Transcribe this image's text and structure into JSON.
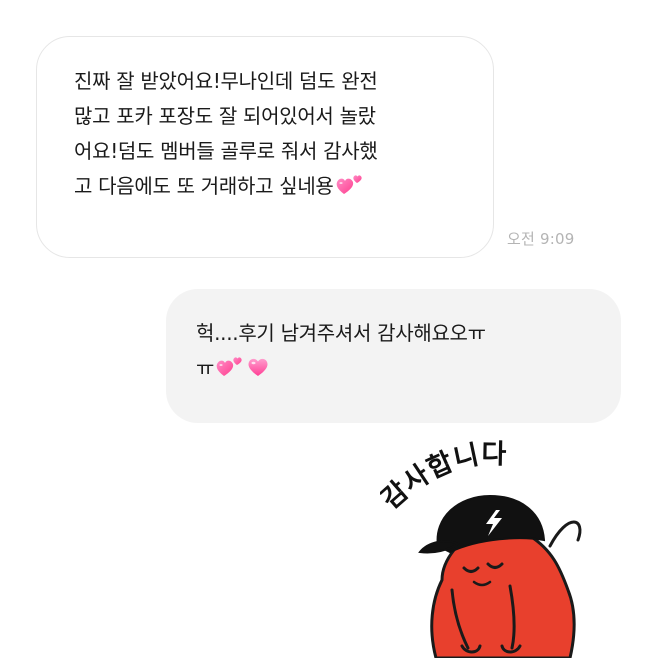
{
  "received_message": {
    "lines": [
      "진짜 잘 받았어요!무나인데 덤도 완전",
      "많고 포카 포장도 잘 되어있어서 놀랐",
      "어요!덤도 멤버들 골루로 줘서 감사했",
      "고 다음에도 또 거래하고 싶네용"
    ],
    "emoji": "two-hearts"
  },
  "received_time": "오전 9:09",
  "sent_message": {
    "lines": [
      "헉....후기 남겨주셔서 감사해요오ㅠ",
      "ㅠ"
    ],
    "emoji": [
      "two-hearts",
      "pink-heart"
    ]
  },
  "sticker": {
    "text": "감사합니다",
    "description_icon": "red-character-bowing-sticker",
    "colors": {
      "body": "#e8402d",
      "cap": "#111111",
      "outline": "#1a1a1a"
    }
  },
  "colors": {
    "received_bubble": "#ffffff",
    "received_border": "#e6e6e6",
    "sent_bubble": "#f3f3f3",
    "time_text": "#b4b4b4",
    "heart_pink": "#ff5aa5"
  }
}
